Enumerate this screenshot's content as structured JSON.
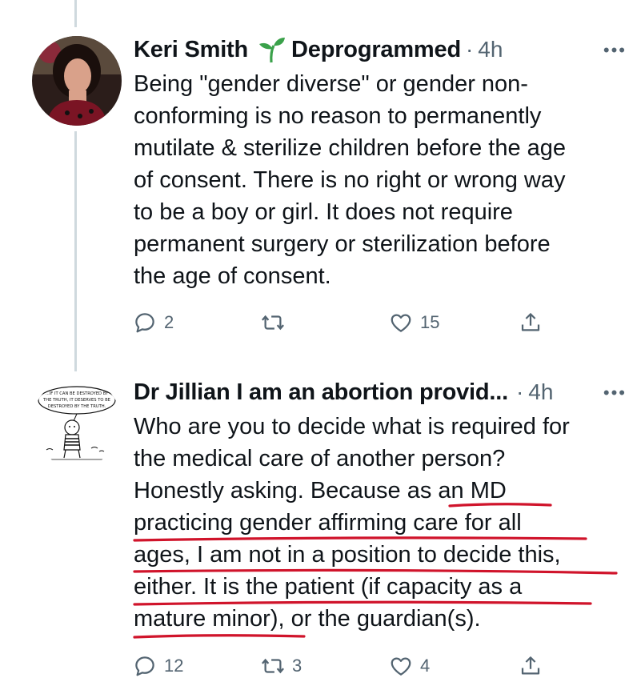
{
  "tweets": [
    {
      "author": "Keri Smith",
      "badge": "Deprogrammed",
      "separator": "·",
      "time": "4h",
      "more": "•••",
      "lines": [
        "Being \"gender diverse\" or gender non-",
        "conforming is no reason to permanently",
        "mutilate & sterilize children before the age",
        "of consent. There is no right or wrong way",
        "to be a boy or girl. It does not require",
        "permanent surgery or sterilization before",
        "the age of consent."
      ],
      "actions": {
        "replies": "2",
        "retweets": "",
        "likes": "15"
      }
    },
    {
      "author": "Dr Jillian I am an abortion provid...",
      "separator": "·",
      "time": "4h",
      "more": "•••",
      "avatar_text": [
        "...IF IT CAN BE DESTROYED BY",
        "THE TRUTH, IT DESERVES TO BE",
        "DESTROYED BY THE TRUTH."
      ],
      "lines": [
        "Who are you to decide what is required for",
        "the medical care of another person?",
        "Honestly asking. Because as an MD",
        "practicing gender affirming care for all",
        "ages, I am not in a position to decide this,",
        "either. It is the patient (if  capacity as a",
        "mature minor), or the guardian(s)."
      ],
      "actions": {
        "replies": "12",
        "retweets": "3",
        "likes": "4"
      }
    }
  ],
  "colors": {
    "text": "#0f1419",
    "muted": "#536471",
    "thread_line": "#cfd9de",
    "sprout": "#3aa14a",
    "annotation_red": "#d0142b"
  },
  "icons": [
    "reply-icon",
    "retweet-icon",
    "like-icon",
    "share-icon",
    "more-icon",
    "sprout-icon"
  ]
}
